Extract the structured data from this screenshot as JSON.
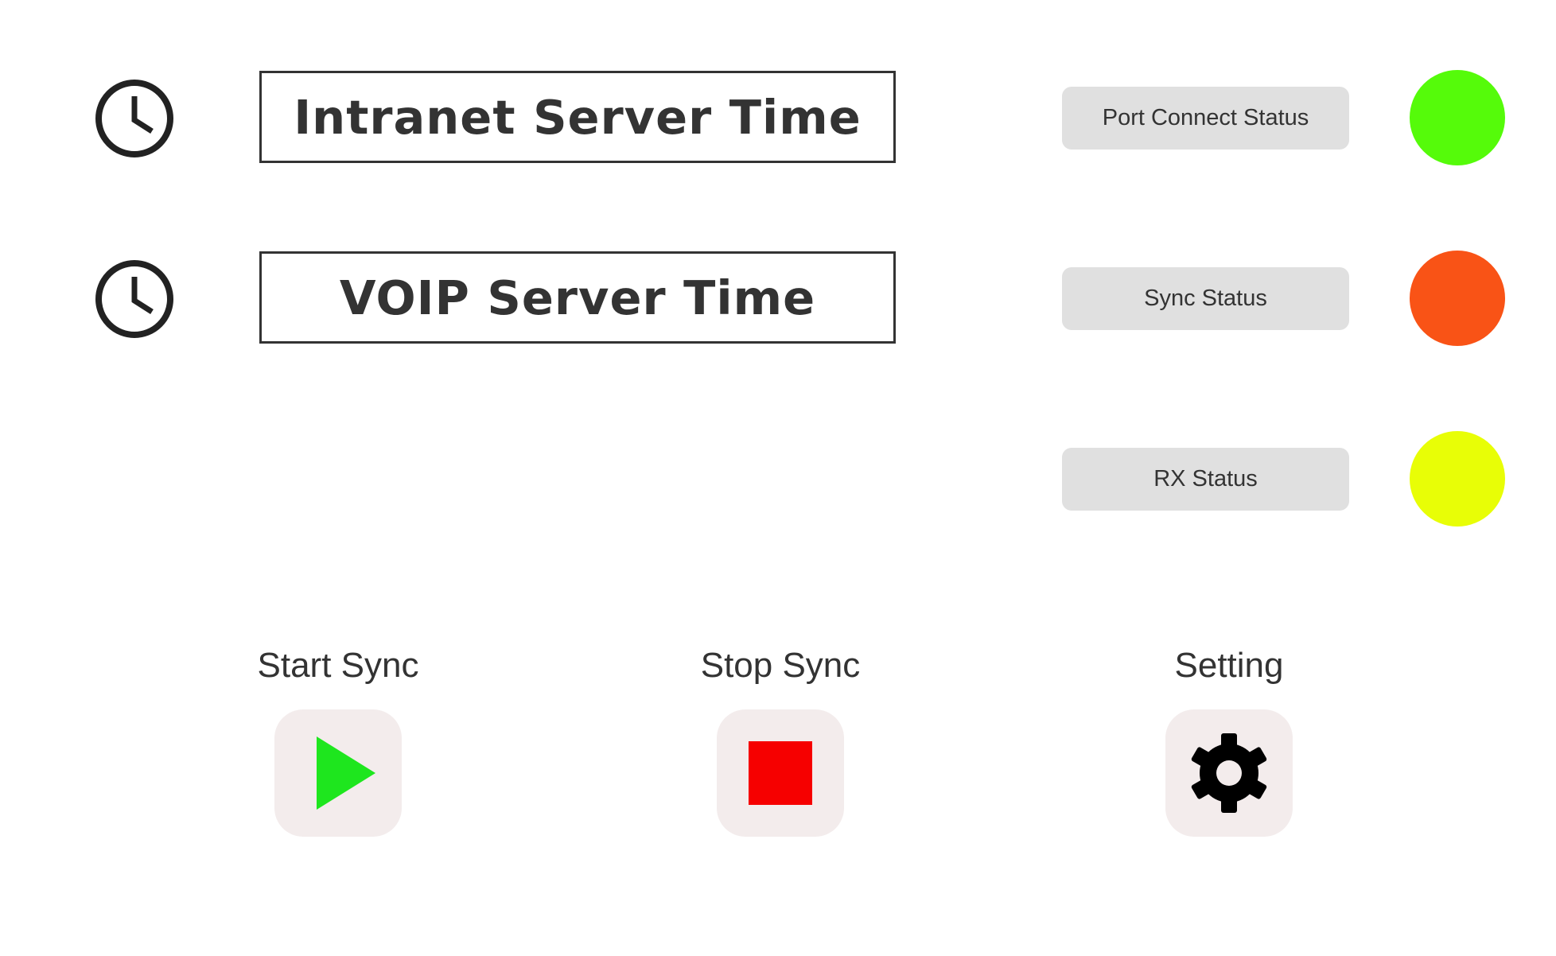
{
  "time_rows": [
    {
      "label": "Intranet Server Time",
      "icon": "clock-icon"
    },
    {
      "label": "VOIP Server Time",
      "icon": "clock-icon"
    }
  ],
  "statuses": [
    {
      "label": "Port Connect Status",
      "color": "#55fb0a"
    },
    {
      "label": "Sync Status",
      "color": "#f95316"
    },
    {
      "label": "RX Status",
      "color": "#e8fe06"
    }
  ],
  "actions": [
    {
      "label": "Start Sync",
      "icon": "play-icon",
      "icon_color": "#1ee61e"
    },
    {
      "label": "Stop Sync",
      "icon": "stop-icon",
      "icon_color": "#f60000"
    },
    {
      "label": "Setting",
      "icon": "gear-icon",
      "icon_color": "#000000"
    }
  ],
  "colors": {
    "text": "#333333",
    "label_bg": "#e0e0e0",
    "button_bg": "#f3ecec"
  }
}
